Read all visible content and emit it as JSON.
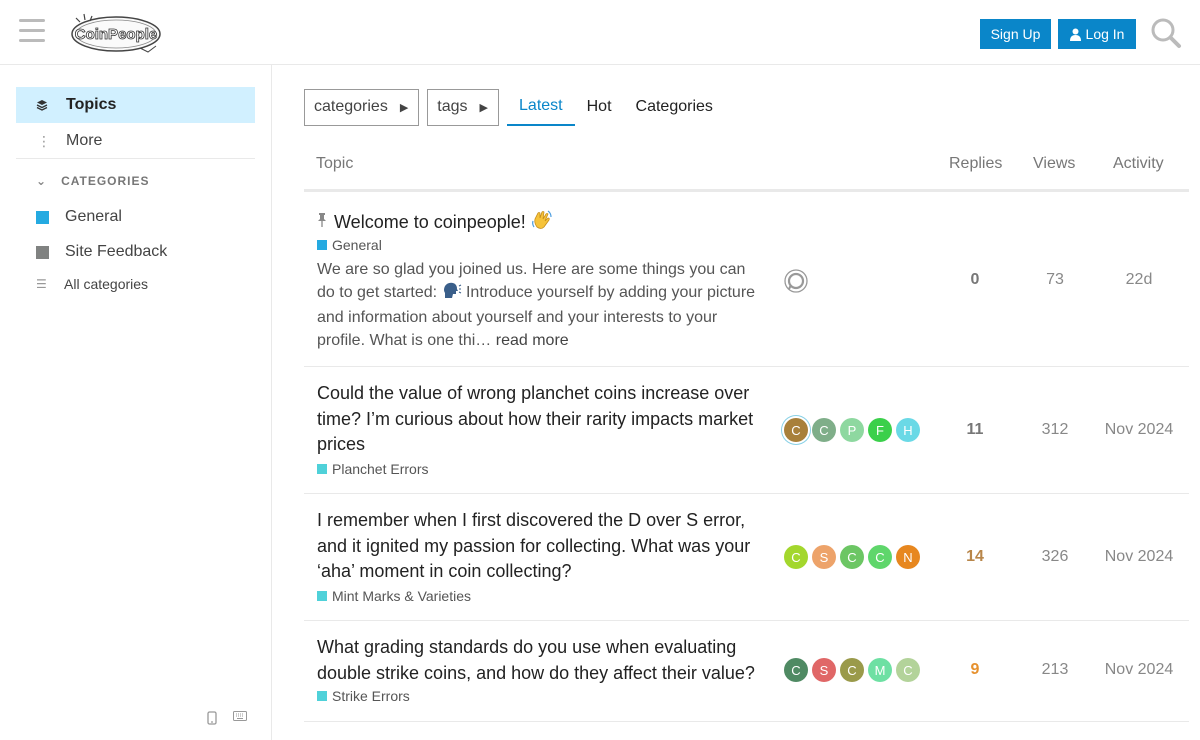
{
  "header": {
    "logo_text": "CoinPeople",
    "signup_label": "Sign Up",
    "login_label": "Log In"
  },
  "sidebar": {
    "topics_label": "Topics",
    "more_label": "More",
    "categories_heading": "CATEGORIES",
    "categories": [
      {
        "label": "General",
        "color": "#25aae1"
      },
      {
        "label": "Site Feedback",
        "color": "#808281"
      }
    ],
    "all_categories_label": "All categories"
  },
  "nav": {
    "categories_dropdown": "categories",
    "tags_dropdown": "tags",
    "tabs": [
      {
        "label": "Latest",
        "active": true
      },
      {
        "label": "Hot",
        "active": false
      },
      {
        "label": "Categories",
        "active": false
      }
    ]
  },
  "table": {
    "headers": {
      "topic": "Topic",
      "replies": "Replies",
      "views": "Views",
      "activity": "Activity"
    },
    "rows": [
      {
        "title": "Welcome to coinpeople!",
        "pinned": true,
        "category": "General",
        "category_color": "#25aae1",
        "excerpt_1": "We are so glad you joined us. Here are some things you can do to get started:",
        "excerpt_2": "Introduce yourself by adding your picture and information about yourself and your interests to your profile. What is one thi…",
        "read_more": "read more",
        "replies": "0",
        "views": "73",
        "activity": "22d"
      },
      {
        "title": "Could the value of wrong planchet coins increase over time? I’m curious about how their rarity impacts market prices",
        "category": "Planchet Errors",
        "category_color": "#4fd1d9",
        "avatars": [
          {
            "letter": "C",
            "color": "#a8803a"
          },
          {
            "letter": "C",
            "color": "#7fae89"
          },
          {
            "letter": "P",
            "color": "#8ed8a0"
          },
          {
            "letter": "F",
            "color": "#3bd04b"
          },
          {
            "letter": "H",
            "color": "#6ad9e6"
          }
        ],
        "replies": "11",
        "views": "312",
        "activity": "Nov 2024"
      },
      {
        "title": "I remember when I first discovered the D over S error, and it ignited my passion for collecting. What was your ‘aha’ moment in coin collecting?",
        "category": "Mint Marks & Varieties",
        "category_color": "#4fd1d9",
        "avatars": [
          {
            "letter": "C",
            "color": "#a3d72d"
          },
          {
            "letter": "S",
            "color": "#eda36a"
          },
          {
            "letter": "C",
            "color": "#6cc664"
          },
          {
            "letter": "C",
            "color": "#5fd66b"
          },
          {
            "letter": "N",
            "color": "#e7871f"
          }
        ],
        "replies": "14",
        "replies_color": "#b8864a",
        "views": "326",
        "activity": "Nov 2024"
      },
      {
        "title": "What grading standards do you use when evaluating double strike coins, and how do they affect their value?",
        "category": "Strike Errors",
        "category_color": "#4fd1d9",
        "avatars": [
          {
            "letter": "C",
            "color": "#4f8a63"
          },
          {
            "letter": "S",
            "color": "#e06767"
          },
          {
            "letter": "C",
            "color": "#9a9a4a"
          },
          {
            "letter": "M",
            "color": "#6ee0a3"
          },
          {
            "letter": "C",
            "color": "#b3d39a"
          }
        ],
        "replies": "9",
        "replies_color": "#e6912e",
        "views": "213",
        "activity": "Nov 2024"
      }
    ]
  }
}
